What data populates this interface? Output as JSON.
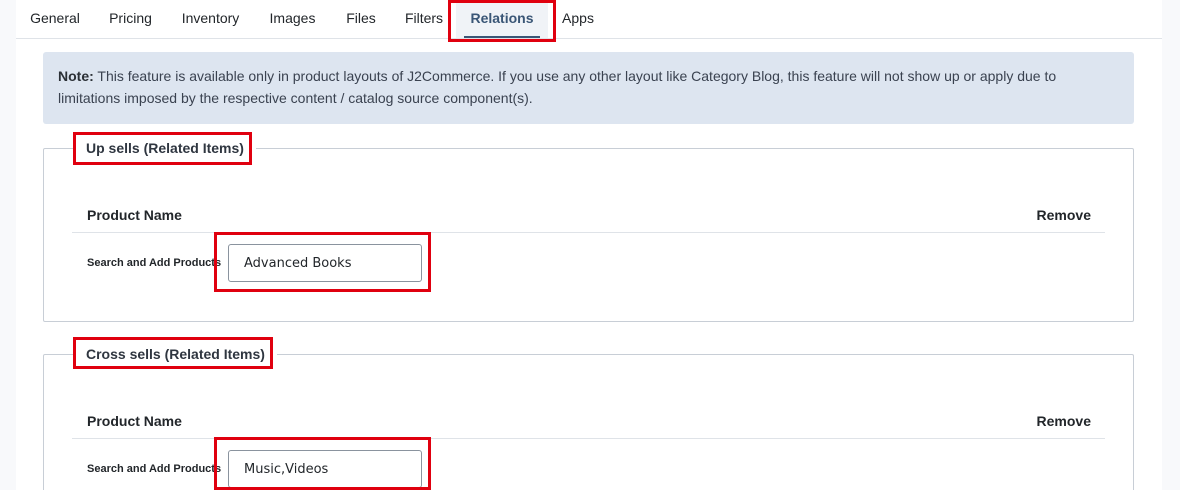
{
  "tabs": [
    {
      "label": "General",
      "active": false
    },
    {
      "label": "Pricing",
      "active": false
    },
    {
      "label": "Inventory",
      "active": false
    },
    {
      "label": "Images",
      "active": false
    },
    {
      "label": "Files",
      "active": false
    },
    {
      "label": "Filters",
      "active": false
    },
    {
      "label": "Relations",
      "active": true
    },
    {
      "label": "Apps",
      "active": false
    }
  ],
  "note": {
    "prefix": "Note:",
    "text": " This feature is available only in product layouts of J2Commerce. If you use any other layout like Category Blog, this feature will not show up or apply due to limitations imposed by the respective content / catalog source component(s)."
  },
  "upsells": {
    "legend": "Up sells (Related Items)",
    "col_product_name": "Product Name",
    "col_remove": "Remove",
    "search_label": "Search and Add Products",
    "search_value": "Advanced Books"
  },
  "crosssells": {
    "legend": "Cross sells (Related Items)",
    "col_product_name": "Product Name",
    "col_remove": "Remove",
    "search_label": "Search and Add Products",
    "search_value": "Music,Videos"
  },
  "colors": {
    "active_tab": "#3a5676",
    "note_bg": "#dde5f0",
    "highlight": "#e0000f"
  }
}
